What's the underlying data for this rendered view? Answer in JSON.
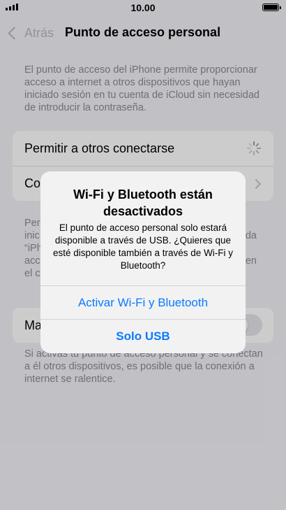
{
  "status_bar": {
    "time": "10.00"
  },
  "nav": {
    "back_label": "Atrás",
    "title": "Punto de acceso personal"
  },
  "description": "El punto de acceso del iPhone permite proporcionar acceso a internet a otros dispositivos que hayan iniciado sesión en tu cuenta de iCloud sin necesidad de introducir la contraseña.",
  "settings": {
    "allow_others_label": "Permitir a otros conectarse",
    "second_row_label": "Co"
  },
  "mid_note": {
    "lines_left": [
      "Per",
      "inic",
      "“iPh",
      "acc",
      "el c"
    ],
    "lines_right": [
      "da",
      "en"
    ]
  },
  "maximize": {
    "label": "Ma"
  },
  "bottom_note": "Si activas tu punto de acceso personal y se conectan a él otros dispositivos, es posible que la conexión a internet se ralentice.",
  "alert": {
    "title": "Wi-Fi y Bluetooth están desactivados",
    "message": "El punto de acceso personal solo estará disponible a través de USB. ¿Quieres que esté disponible también a través de Wi-Fi y Bluetooth?",
    "button_enable": "Activar Wi-Fi y Bluetooth",
    "button_usb": "Solo USB"
  },
  "colors": {
    "accent": "#0a7aff",
    "background": "#f2f2f7"
  },
  "icons": [
    "signal-icon",
    "battery-icon",
    "back-chevron-icon",
    "activity-spinner-icon",
    "chevron-right-icon"
  ]
}
